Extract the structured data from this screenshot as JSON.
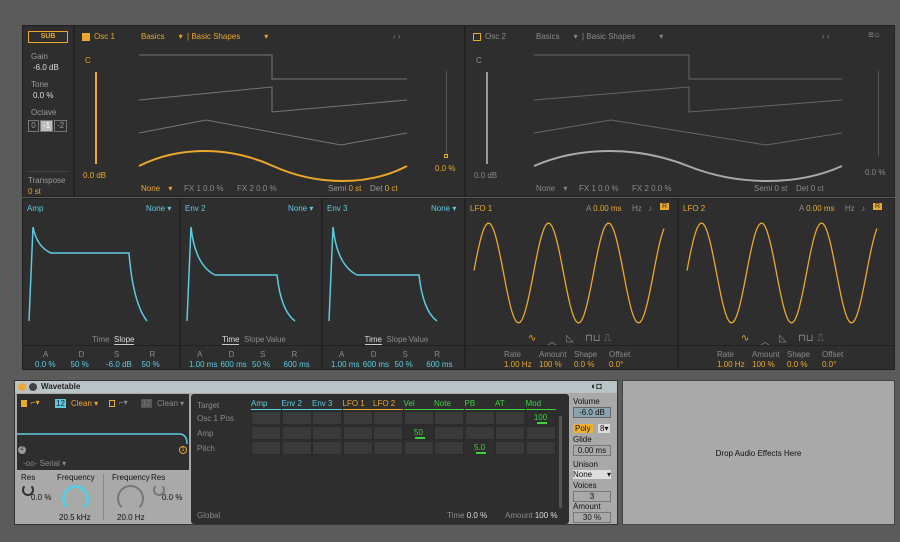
{
  "colors": {
    "accent": "#e9a82b",
    "env": "#5ccbe0",
    "mod": "#3fd23f",
    "panel": "#2e2e2e"
  },
  "sub": {
    "label": "SUB",
    "gain_label": "Gain",
    "gain": "-6.0 dB",
    "tone_label": "Tone",
    "tone": "0.0 %",
    "octave_label": "Octave",
    "octaves": [
      "0",
      "-1",
      "-2"
    ],
    "transpose_label": "Transpose",
    "transpose": "0 st"
  },
  "osc1": {
    "title": "Osc 1",
    "category": "Basics",
    "wavetable": "Basic Shapes",
    "note": "C",
    "gain": "0.0 dB",
    "position": "0.0 %",
    "fx_mode": "None",
    "fx1": "FX 1 0.0 %",
    "fx2": "FX 2 0.0 %",
    "semi_label": "Semi",
    "semi": "0 st",
    "det_label": "Det",
    "det": "0 ct"
  },
  "osc2": {
    "title": "Osc 2",
    "category": "Basics",
    "wavetable": "Basic Shapes",
    "note": "C",
    "gain": "0.0 dB",
    "position": "0.0 %",
    "fx_mode": "None",
    "fx1": "FX 1 0.0 %",
    "fx2": "FX 2 0.0 %",
    "semi_label": "Semi",
    "semi": "0 st",
    "det_label": "Det",
    "det": "0 ct"
  },
  "envs": [
    {
      "title": "Amp",
      "mode": "None",
      "tabs": [
        "Time",
        "Slope"
      ],
      "active_tab": "Slope",
      "params": [
        [
          "A",
          "0.0 %"
        ],
        [
          "D",
          "50 %"
        ],
        [
          "S",
          "-6.0 dB"
        ],
        [
          "R",
          "50 %"
        ]
      ]
    },
    {
      "title": "Env 2",
      "mode": "None",
      "tabs": [
        "Time",
        "Slope",
        "Value"
      ],
      "active_tab": "Time",
      "params": [
        [
          "A",
          "1.00 ms"
        ],
        [
          "D",
          "600 ms"
        ],
        [
          "S",
          "50 %"
        ],
        [
          "R",
          "600 ms"
        ]
      ]
    },
    {
      "title": "Env 3",
      "mode": "None",
      "tabs": [
        "Time",
        "Slope",
        "Value"
      ],
      "active_tab": "Time",
      "params": [
        [
          "A",
          "1.00 ms"
        ],
        [
          "D",
          "600 ms"
        ],
        [
          "S",
          "50 %"
        ],
        [
          "R",
          "600 ms"
        ]
      ]
    }
  ],
  "lfos": [
    {
      "title": "LFO 1",
      "attack_label": "A",
      "attack": "0.00 ms",
      "hz": "Hz",
      "retrig": "R",
      "params": [
        [
          "Rate",
          "1.00 Hz"
        ],
        [
          "Amount",
          "100 %"
        ],
        [
          "Shape",
          "0.0 %"
        ],
        [
          "Offset",
          "0.0°"
        ]
      ],
      "shape": "sine"
    },
    {
      "title": "LFO 2",
      "attack_label": "A",
      "attack": "0.00 ms",
      "hz": "Hz",
      "retrig": "R",
      "params": [
        [
          "Rate",
          "1.00 Hz"
        ],
        [
          "Amount",
          "100 %"
        ],
        [
          "Shape",
          "0.0 %"
        ],
        [
          "Offset",
          "0.0°"
        ]
      ],
      "shape": "sine"
    }
  ],
  "device": {
    "title": "Wavetable",
    "filter1_type": "12",
    "filter1_circuit": "Clean",
    "filter2_type": "12",
    "filter2_circuit": "Clean",
    "routing": "Serial",
    "f1_res_label": "Res",
    "f1_res": "0.0 %",
    "f1_freq_label": "Frequency",
    "f1_freq": "20.5 kHz",
    "f2_freq_label": "Frequency",
    "f2_freq": "20.0 Hz",
    "f2_res_label": "Res",
    "f2_res": "0.0 %"
  },
  "matrix": {
    "target_label": "Target",
    "sources": [
      "Amp",
      "Env 2",
      "Env 3",
      "LFO 1",
      "LFO 2",
      "Vel",
      "Note",
      "PB",
      "AT",
      "Mod"
    ],
    "rows": [
      {
        "label": "Osc 1 Pos",
        "values": {
          "9": "100"
        }
      },
      {
        "label": "Amp",
        "values": {
          "5": "50"
        }
      },
      {
        "label": "Pitch",
        "values": {
          "7": "5.0"
        }
      }
    ],
    "global_label": "Global",
    "time_label": "Time",
    "time": "0.0 %",
    "amount_label": "Amount",
    "amount": "100 %"
  },
  "global": {
    "volume_label": "Volume",
    "volume": "-6.0 dB",
    "poly": "Poly",
    "voices_count": "8",
    "glide_label": "Glide",
    "glide": "0.00 ms",
    "unison_label": "Unison",
    "unison": "None",
    "voices_label": "Voices",
    "voices": "3",
    "amount_label": "Amount",
    "amount": "30 %"
  },
  "drop_text": "Drop Audio Effects Here"
}
